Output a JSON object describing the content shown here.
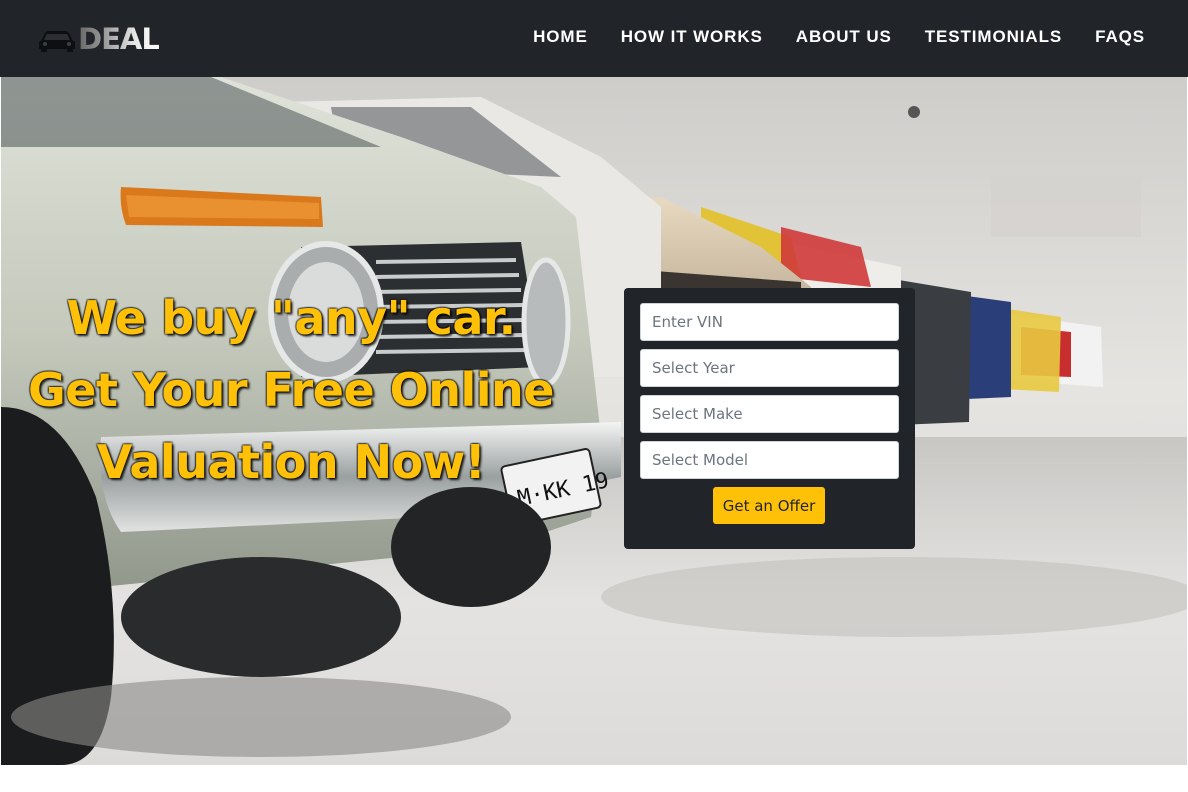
{
  "brand": {
    "logo_text": "DEAL",
    "logo_icon": "car-icon"
  },
  "nav": {
    "items": [
      {
        "label": "HOME"
      },
      {
        "label": "HOW IT WORKS"
      },
      {
        "label": "ABOUT US"
      },
      {
        "label": "TESTIMONIALS"
      },
      {
        "label": "FAQS"
      }
    ]
  },
  "hero": {
    "headline": {
      "line1": "We buy \"any\" car.",
      "line2": "Get Your Free Online",
      "line3": "Valuation Now!"
    },
    "plate_text": "M·KK 19"
  },
  "form": {
    "vin_placeholder": "Enter VIN",
    "year_placeholder": "Select Year",
    "make_placeholder": "Select Make",
    "model_placeholder": "Select Model",
    "submit_label": "Get an Offer"
  },
  "colors": {
    "accent": "#ffc107",
    "navbar": "#212529",
    "card": "#212529"
  }
}
